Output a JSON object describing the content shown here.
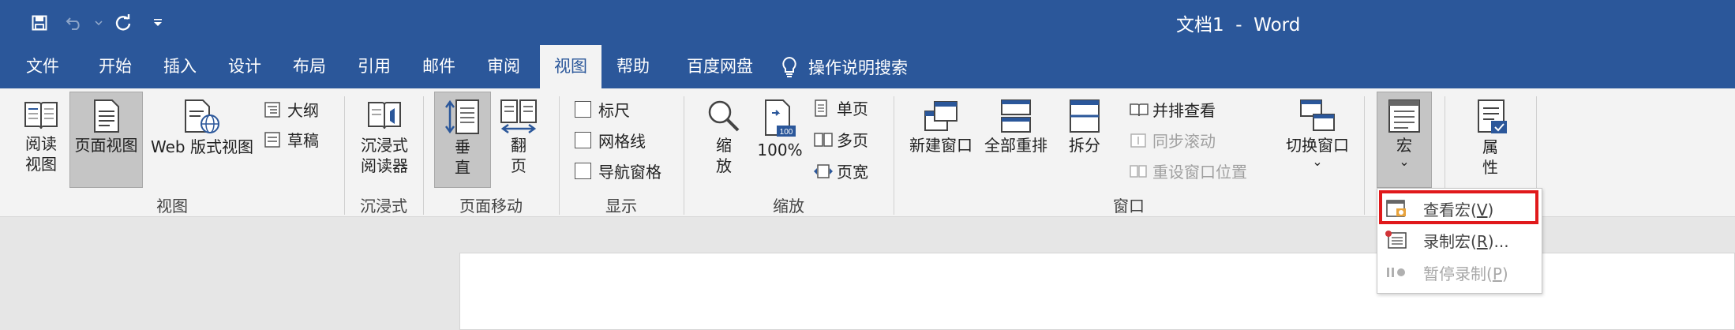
{
  "app": {
    "title": "文档1  -  Word"
  },
  "qat": {
    "icons": [
      "save-icon",
      "undo-icon",
      "redo-icon",
      "customize-icon"
    ]
  },
  "tabs": [
    {
      "label": "文件",
      "active": false
    },
    {
      "label": "开始",
      "active": false
    },
    {
      "label": "插入",
      "active": false
    },
    {
      "label": "设计",
      "active": false
    },
    {
      "label": "布局",
      "active": false
    },
    {
      "label": "引用",
      "active": false
    },
    {
      "label": "邮件",
      "active": false
    },
    {
      "label": "审阅",
      "active": false
    },
    {
      "label": "视图",
      "active": true
    },
    {
      "label": "帮助",
      "active": false
    },
    {
      "label": "百度网盘",
      "active": false
    }
  ],
  "search_tab": {
    "label": "操作说明搜索"
  },
  "ribbon": {
    "views": {
      "group_label": "视图",
      "read_line1": "阅读",
      "read_line2": "视图",
      "page_view": "页面视图",
      "web_view": "Web 版式视图",
      "outline": "大纲",
      "draft": "草稿"
    },
    "immersive": {
      "group_label": "沉浸式",
      "reader_line1": "沉浸式",
      "reader_line2": "阅读器"
    },
    "page_move": {
      "group_label": "页面移动",
      "vertical_line1": "垂",
      "vertical_line2": "直",
      "flip_line1": "翻",
      "flip_line2": "页"
    },
    "show": {
      "group_label": "显示",
      "ruler": "标尺",
      "gridlines": "网格线",
      "nav_pane": "导航窗格"
    },
    "zoom": {
      "group_label": "缩放",
      "zoom_line1": "缩",
      "zoom_line2": "放",
      "percent": "100%",
      "icon_text": "100",
      "one_page": "单页",
      "multi_page": "多页",
      "page_width": "页宽"
    },
    "window": {
      "group_label": "窗口",
      "new_window": "新建窗口",
      "arrange_all": "全部重排",
      "split": "拆分",
      "side_by_side": "并排查看",
      "sync_scroll": "同步滚动",
      "reset_position": "重设窗口位置",
      "switch_windows": "切换窗口"
    },
    "macros": {
      "label": "宏"
    },
    "properties": {
      "line1": "属",
      "line2": "性"
    },
    "dropdown_caret": "⌄"
  },
  "macro_menu": {
    "items": [
      {
        "label": "查看宏",
        "key": "V",
        "suffix": "",
        "disabled": false
      },
      {
        "label": "录制宏",
        "key": "R",
        "suffix": "...",
        "disabled": false
      },
      {
        "label": "暂停录制",
        "key": "P",
        "suffix": "",
        "disabled": true
      }
    ]
  },
  "colors": {
    "accent": "#2b579a",
    "highlight": "#e0191b"
  }
}
